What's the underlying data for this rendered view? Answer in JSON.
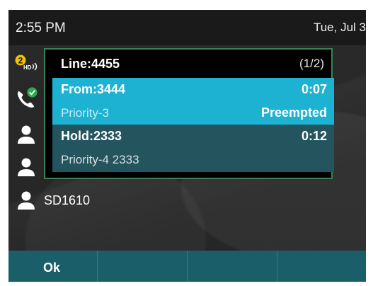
{
  "status": {
    "time": "2:55 PM",
    "date": "Tue, Jul 3"
  },
  "left_icons": {
    "hd_badge_count": "2",
    "hd_label": "HD",
    "phone_icon": "phone-check-icon",
    "contact_icon": "contact-icon"
  },
  "popup": {
    "line_label": "Line:4455",
    "page_counter": "(1/2)",
    "calls": [
      {
        "primary": "From:3444",
        "timer": "0:07",
        "secondary": "Priority-3",
        "state": "Preempted"
      },
      {
        "primary": "Hold:2333",
        "timer": "0:12",
        "secondary": "Priority-4 2333"
      }
    ]
  },
  "speed_dial": {
    "label": "SD1610"
  },
  "softkeys": {
    "k1": "Ok",
    "k2": "",
    "k3": "",
    "k4": ""
  },
  "colors": {
    "active_call": "#1eb2d2",
    "held_call": "#24555f",
    "popup_border": "#3e7f53",
    "softkey_bar": "#1a5e69",
    "badge": "#f2c200",
    "check": "#2fa84f"
  }
}
